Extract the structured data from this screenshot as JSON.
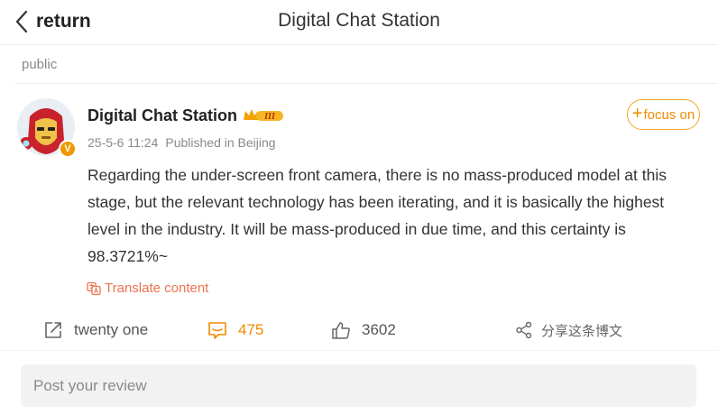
{
  "header": {
    "back_label": "return",
    "title": "Digital Chat Station"
  },
  "section": {
    "label": "public"
  },
  "post": {
    "author": "Digital Chat Station",
    "avatar_badge": "V",
    "vip_level": "III",
    "timestamp": "25-5-6 11:24",
    "location": "Published in Beijing",
    "follow_label": "focus on",
    "text": "Regarding the under-screen front camera, there is no mass-produced model at this stage, but the relevant technology has been iterating, and it is basically the highest level in the industry. It will be mass-produced in due time, and this certainty is 98.3721%~",
    "translate_label": "Translate content"
  },
  "actions": {
    "forward_count": "twenty one",
    "comment_count": "475",
    "like_count": "3602",
    "share_label": "分享这条博文"
  },
  "review": {
    "placeholder": "Post your review"
  },
  "colors": {
    "accent": "#f08a00",
    "translate": "#eb7350",
    "verified": "#f09800"
  },
  "icons": {
    "back": "chevron-left-icon",
    "forward": "forward-icon",
    "comment": "comment-icon",
    "like": "thumbs-up-icon",
    "share": "share-icon",
    "translate": "translate-icon"
  }
}
